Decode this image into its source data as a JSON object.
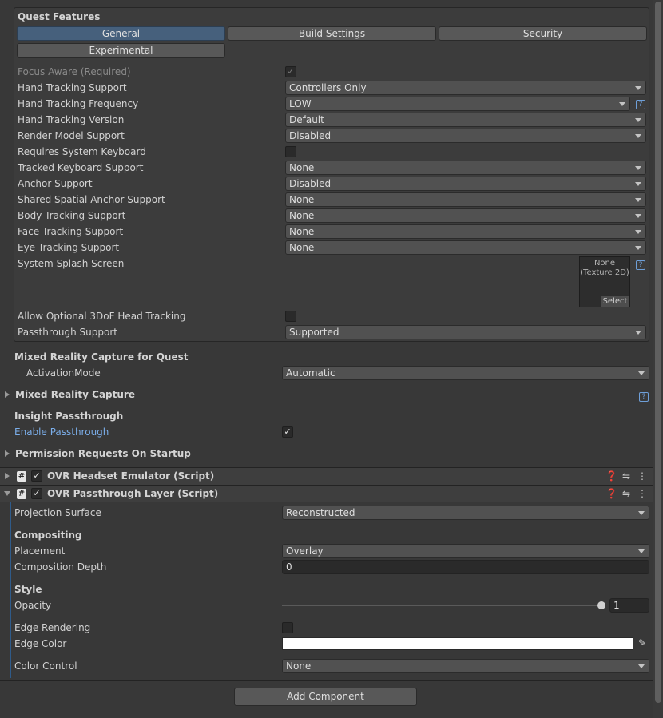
{
  "quest_features": {
    "title": "Quest Features",
    "tabs": [
      "General",
      "Build Settings",
      "Security",
      "Experimental"
    ],
    "rows": [
      {
        "label": "Focus Aware (Required)",
        "value": "✓"
      },
      {
        "label": "Hand Tracking Support",
        "value": "Controllers Only"
      },
      {
        "label": "Hand Tracking Frequency",
        "value": "LOW"
      },
      {
        "label": "Hand Tracking Version",
        "value": "Default"
      },
      {
        "label": "Render Model Support",
        "value": "Disabled"
      },
      {
        "label": "Requires System Keyboard",
        "value": ""
      },
      {
        "label": "Tracked Keyboard Support",
        "value": "None"
      },
      {
        "label": "Anchor Support",
        "value": "Disabled"
      },
      {
        "label": "Shared Spatial Anchor Support",
        "value": "None"
      },
      {
        "label": "Body Tracking Support",
        "value": "None"
      },
      {
        "label": "Face Tracking Support",
        "value": "None"
      },
      {
        "label": "Eye Tracking Support",
        "value": "None"
      },
      {
        "label": "System Splash Screen",
        "value": ""
      },
      {
        "label": "Allow Optional 3DoF Head Tracking",
        "value": ""
      },
      {
        "label": "Passthrough Support",
        "value": "Supported"
      }
    ],
    "help": "?",
    "splash": {
      "line1": "None",
      "line2": "(Texture 2D)",
      "select": "Select"
    }
  },
  "mrc_quest": {
    "title": "Mixed Reality Capture for Quest",
    "label": "ActivationMode",
    "value": "Automatic"
  },
  "mrc": {
    "title": "Mixed Reality Capture",
    "help": "?"
  },
  "insight": {
    "title": "Insight Passthrough",
    "label": "Enable Passthrough",
    "check": "✓"
  },
  "permission": {
    "title": "Permission Requests On Startup"
  },
  "components": [
    {
      "title": "OVR Headset Emulator (Script)",
      "icon": "#",
      "check": "✓"
    },
    {
      "title": "OVR Passthrough Layer (Script)",
      "icon": "#",
      "check": "✓"
    }
  ],
  "passthrough_layer": {
    "projection_label": "Projection Surface",
    "projection_value": "Reconstructed",
    "compositing_title": "Compositing",
    "placement_label": "Placement",
    "placement_value": "Overlay",
    "depth_label": "Composition Depth",
    "depth_value": "0",
    "style_title": "Style",
    "opacity_label": "Opacity",
    "opacity_value": "1",
    "opacity_level": 1.0,
    "edge_rendering_label": "Edge Rendering",
    "edge_color_label": "Edge Color",
    "edge_color_value": "#ffffff",
    "color_control_label": "Color Control",
    "color_control_value": "None"
  },
  "add_component": "Add Component",
  "colors": {
    "accent_tab": "#46607c",
    "link": "#7baeea",
    "background": "#383838"
  }
}
